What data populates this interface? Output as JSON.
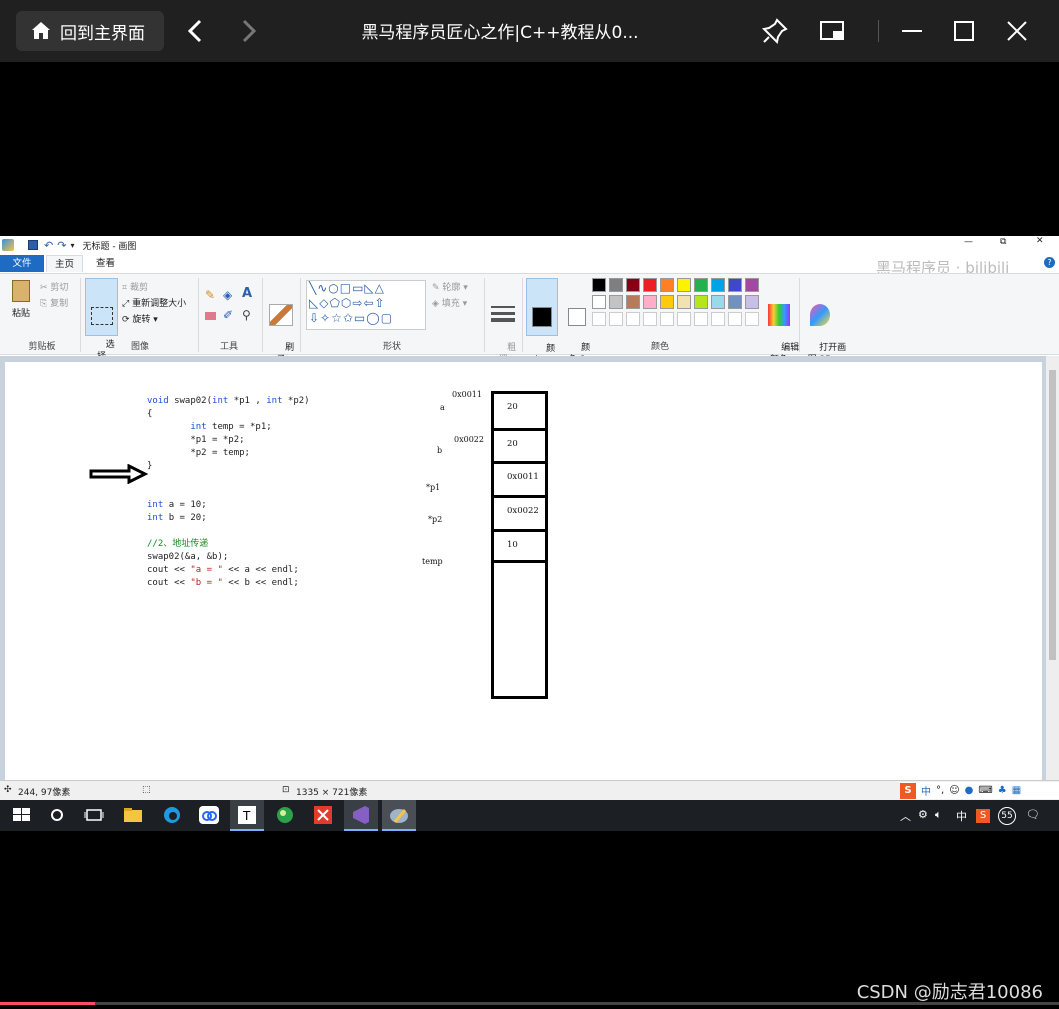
{
  "player": {
    "home_label": "回到主界面",
    "title": "黑马程序员匠心之作|C++教程从0...",
    "progress": 0.09
  },
  "paint": {
    "title": "无标题 - 画图",
    "tabs": [
      "文件",
      "主页",
      "查看"
    ],
    "clipboard": {
      "paste": "粘贴",
      "cut": "剪切",
      "copy": "复制",
      "label": "剪贴板"
    },
    "image": {
      "select": "选\n择",
      "crop": "裁剪",
      "resize": "重新调整大小",
      "rotate": "旋转",
      "label": "图像"
    },
    "tools_label": "工具",
    "brush": "刷\n子",
    "shapes": {
      "outline": "轮廓",
      "fill": "填充",
      "label": "形状"
    },
    "size": "粗\n细",
    "color1": "颜\n色 1",
    "color2": "颜\n色 2",
    "edit_colors": "编辑\n颜色",
    "open_3d": "打开画\n图 3D",
    "colors_label": "颜色",
    "palette_row1": [
      "#000000",
      "#7f7f7f",
      "#880015",
      "#ed1c24",
      "#ff7f27",
      "#fff200",
      "#22b14c",
      "#00a2e8",
      "#3f48cc",
      "#a349a4"
    ],
    "palette_row2": [
      "#ffffff",
      "#c3c3c3",
      "#b97a57",
      "#ffaec9",
      "#ffc90e",
      "#efe4b0",
      "#b5e61d",
      "#99d9ea",
      "#7092be",
      "#c8bfe7"
    ],
    "watermark": "黑马程序员 · bilibili",
    "status_pos": "244, 97像素",
    "status_size": "1335 × 721像素"
  },
  "canvas": {
    "code_lines": [
      [
        {
          "t": "void ",
          "c": "kw"
        },
        {
          "t": "swap02(",
          "c": ""
        },
        {
          "t": "int ",
          "c": "kw"
        },
        {
          "t": "*p1 , ",
          "c": ""
        },
        {
          "t": "int ",
          "c": "kw"
        },
        {
          "t": "*p2)",
          "c": ""
        }
      ],
      [
        {
          "t": "{",
          "c": ""
        }
      ],
      [
        {
          "t": "        ",
          "c": ""
        },
        {
          "t": "int ",
          "c": "kw"
        },
        {
          "t": "temp = *p1;",
          "c": ""
        }
      ],
      [
        {
          "t": "        *p1 = *p2;",
          "c": ""
        }
      ],
      [
        {
          "t": "        *p2 = temp;",
          "c": ""
        }
      ],
      [
        {
          "t": "}",
          "c": ""
        }
      ]
    ],
    "main_lines": [
      [
        {
          "t": "int ",
          "c": "kw"
        },
        {
          "t": "a = 10;",
          "c": ""
        }
      ],
      [
        {
          "t": "int ",
          "c": "kw"
        },
        {
          "t": "b = 20;",
          "c": ""
        }
      ],
      [
        {
          "t": "",
          "c": ""
        }
      ],
      [
        {
          "t": "//2、地址传递",
          "c": "cmt"
        }
      ],
      [
        {
          "t": "swap02(&a, &b);",
          "c": ""
        }
      ],
      [
        {
          "t": "cout << ",
          "c": ""
        },
        {
          "t": "\"a = \"",
          "c": "str"
        },
        {
          "t": " << a << endl;",
          "c": ""
        }
      ],
      [
        {
          "t": "cout << ",
          "c": ""
        },
        {
          "t": "\"b = \"",
          "c": "str"
        },
        {
          "t": " << b << endl;",
          "c": ""
        }
      ]
    ],
    "labels": {
      "addr_a": "0x0011",
      "a": "a",
      "addr_b": "0x0022",
      "b": "b",
      "p1": "*p1",
      "p2": "*p2",
      "temp": "temp"
    },
    "cells": [
      "20",
      "20",
      "0x0011",
      "0x0022",
      "10",
      ""
    ]
  },
  "taskbar": {
    "ime": "中",
    "num": "55"
  },
  "watermark": "CSDN @励志君10086"
}
